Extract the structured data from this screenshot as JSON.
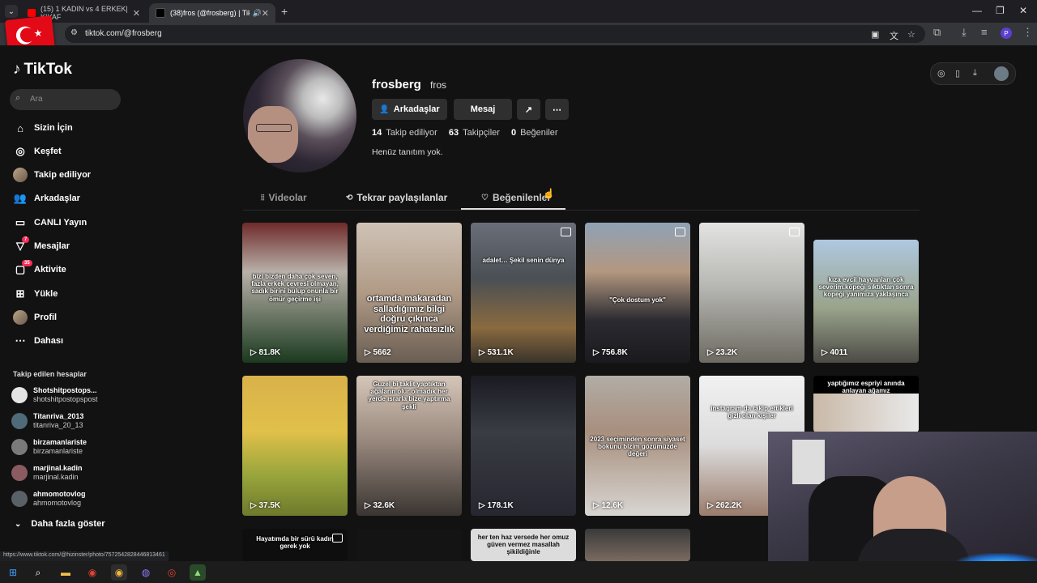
{
  "browser": {
    "tabs": [
      {
        "title": "(15) 1 KADIN vs 4 ERKEK| KIYAF",
        "active": false
      },
      {
        "title": "(38)fros (@frosberg) | TikTok",
        "active": true
      }
    ],
    "url": "tiktok.com/@frosberg",
    "profile_initial": "P"
  },
  "sidebar": {
    "logo": "TikTok",
    "search_placeholder": "Ara",
    "items": [
      {
        "label": "Sizin İçin",
        "icon": "home-icon"
      },
      {
        "label": "Keşfet",
        "icon": "compass-icon"
      },
      {
        "label": "Takip ediliyor",
        "icon": "avatar"
      },
      {
        "label": "Arkadaşlar",
        "icon": "friends-icon"
      },
      {
        "label": "CANLI Yayın",
        "icon": "live-icon"
      },
      {
        "label": "Mesajlar",
        "icon": "message-icon",
        "badge": "7"
      },
      {
        "label": "Aktivite",
        "icon": "inbox-icon",
        "badge": "35"
      },
      {
        "label": "Yükle",
        "icon": "upload-icon"
      },
      {
        "label": "Profil",
        "icon": "avatar"
      },
      {
        "label": "Dahası",
        "icon": "more-icon"
      }
    ],
    "following_title": "Takip edilen hesaplar",
    "following": [
      {
        "name": "Shotshitpostops...",
        "handle": "shotshitpostopspost"
      },
      {
        "name": "Titanriva_2013",
        "handle": "titanriva_20_13"
      },
      {
        "name": "birzamanlariste",
        "handle": "birzamanlariste"
      },
      {
        "name": "marjinal.kadin",
        "handle": "marjinal.kadin"
      },
      {
        "name": "ahmomotovlog",
        "handle": "ahmomotovlog"
      }
    ],
    "more_label": "Daha fazla göster"
  },
  "profile": {
    "username": "frosberg",
    "nickname": "fros",
    "buttons": {
      "friends": "Arkadaşlar",
      "message": "Mesaj"
    },
    "stats": [
      {
        "num": "14",
        "label": "Takip ediliyor"
      },
      {
        "num": "63",
        "label": "Takipçiler"
      },
      {
        "num": "0",
        "label": "Beğeniler"
      }
    ],
    "bio": "Henüz tanıtım yok.",
    "tabs": [
      "Videolar",
      "Tekrar paylaşılanlar",
      "Beğenilenler"
    ],
    "selected_tab": "Beğenilenler"
  },
  "videos": [
    {
      "caption": "bizi bizden daha çok seven, fazla erkek çevresi olmayan, sadık birini bulup onunla bir ömür geçirme işi",
      "views": "81.8K"
    },
    {
      "caption": "ortamda makaradan salladığımız bilgi doğru çıkınca verdiğimiz rahatsızlık",
      "views": "5662"
    },
    {
      "caption": "adalet… Şekil senin dünya",
      "views": "531.1K"
    },
    {
      "caption": "\"Çok dostum yok\"",
      "views": "756.8K"
    },
    {
      "caption": "",
      "views": "23.2K"
    },
    {
      "caption": "kıza evcil hayvanları çok severim.köpeği sıktıktan sonra köpeği yanımıza yaklaşınca",
      "views": "4011"
    },
    {
      "caption": "",
      "views": "37.5K"
    },
    {
      "caption": "Guzel bi taklit yaptıktan ağaların olur olmadık her yerde ısrarla bize yaptırma şekli",
      "views": "32.6K"
    },
    {
      "caption": "",
      "views": "178.1K"
    },
    {
      "caption": "2023 seçiminden sonra siyaset bokunu bizim gözümüzde değeri",
      "views": "12.6K"
    },
    {
      "caption": "instagram da takip ettikleri gizli olan kişiler",
      "views": "262.2K"
    },
    {
      "caption": "yaptığımız espriyi anında anlayan ağamız",
      "views": ""
    },
    {
      "caption": "Hayatımda bir sürü kadın gerek yok",
      "views": ""
    },
    {
      "caption": "",
      "views": ""
    },
    {
      "caption": "her ten haz versede her omuz güven vermez masallah şikildiğinle",
      "views": ""
    },
    {
      "caption": "",
      "views": ""
    }
  ],
  "status_url": "https://www.tiktok.com/@hizinster/photo/7572542828446813461"
}
